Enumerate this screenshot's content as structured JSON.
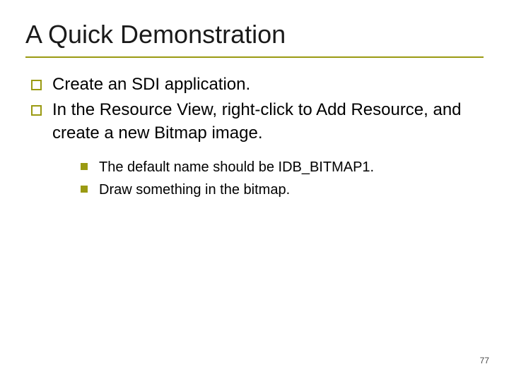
{
  "slide": {
    "title": "A Quick Demonstration",
    "bullets": [
      {
        "text": "Create an SDI application."
      },
      {
        "text": "In the Resource View, right-click to Add Resource, and create a new Bitmap image."
      }
    ],
    "sub_bullets": [
      {
        "text": "The default name should be IDB_BITMAP1."
      },
      {
        "text": "Draw something in the bitmap."
      }
    ],
    "page_number": "77"
  }
}
